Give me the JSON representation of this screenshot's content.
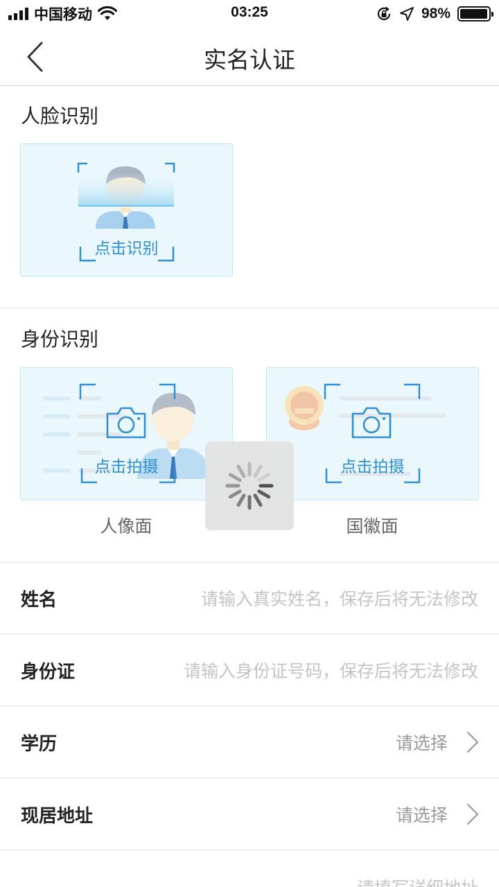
{
  "status_bar": {
    "carrier": "中国移动",
    "time": "03:25",
    "battery": "98%",
    "battery_level": 0.98,
    "icons": [
      "signal-icon",
      "wifi-icon",
      "rotation-lock-icon",
      "location-icon",
      "battery-icon"
    ]
  },
  "nav": {
    "title": "实名认证",
    "back_icon": "chevron-left-icon"
  },
  "face_section": {
    "title": "人脸识别",
    "card_label": "点击识别"
  },
  "id_section": {
    "title": "身份识别",
    "front": {
      "card_label": "点击拍摄",
      "caption": "人像面"
    },
    "back": {
      "card_label": "点击拍摄",
      "caption": "国徽面"
    }
  },
  "form": {
    "name": {
      "label": "姓名",
      "placeholder": "请输入真实姓名，保存后将无法修改"
    },
    "id_card": {
      "label": "身份证",
      "placeholder": "请输入身份证号码，保存后将无法修改"
    },
    "education": {
      "label": "学历",
      "value": "请选择"
    },
    "address": {
      "label": "现居地址",
      "value": "请选择"
    },
    "address_detail": {
      "placeholder": "请填写详细地址"
    }
  },
  "colors": {
    "card_bg": "#eaf8fd",
    "accent_blue": "#2f8fd0",
    "placeholder": "#c4c4c4"
  }
}
